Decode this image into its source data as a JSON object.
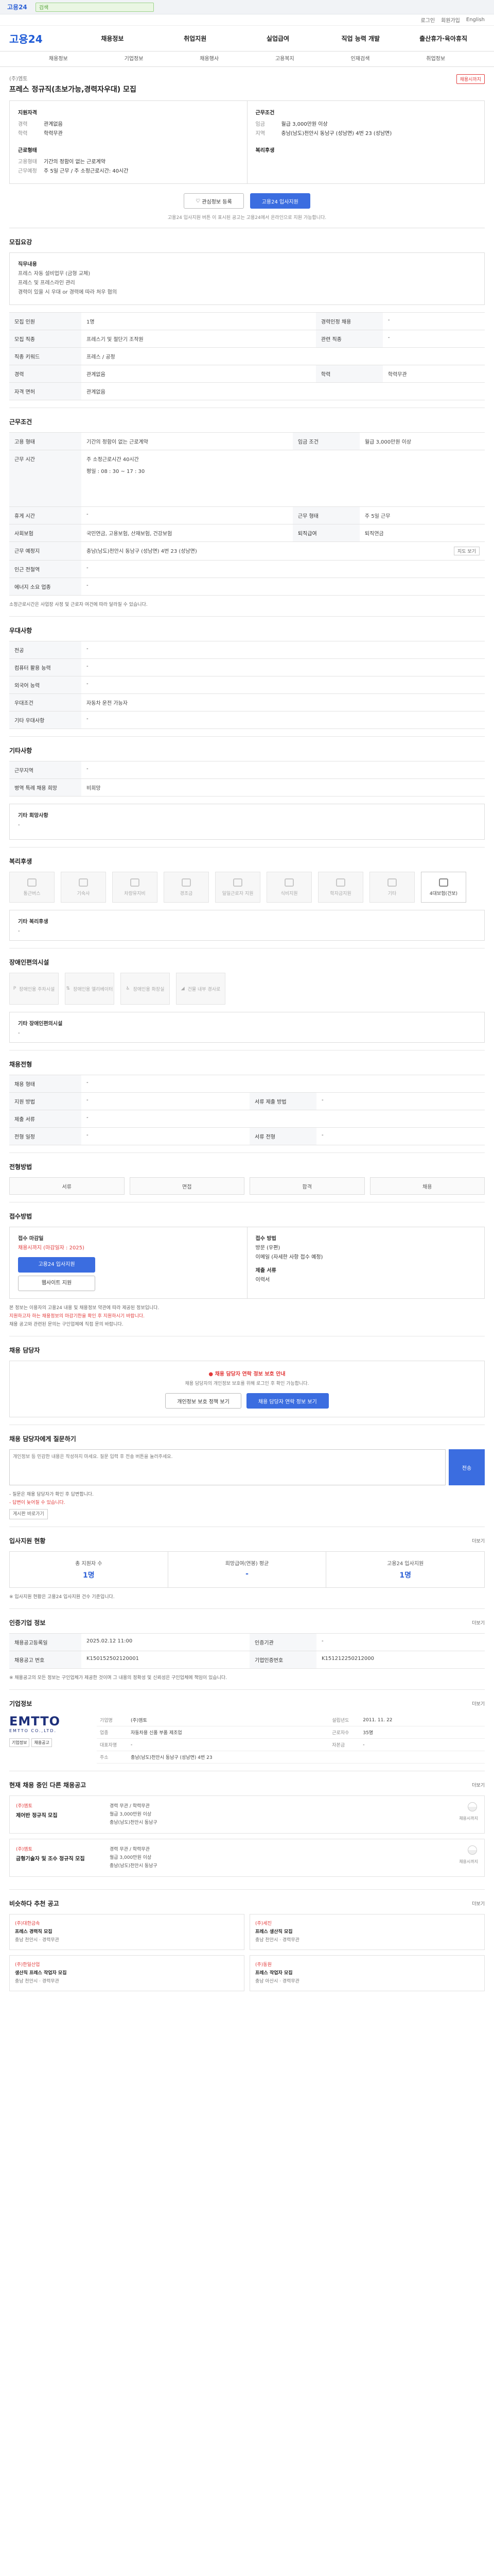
{
  "topbar": {
    "logo": "고용24",
    "search_placeholder": "검색"
  },
  "utilbar": [
    "로그인",
    "회원가입",
    "English"
  ],
  "gnb": {
    "logo": "고용24",
    "menu": [
      "채용정보",
      "취업지원",
      "실업급여",
      "직업 능력 개발",
      "출산휴가·육아휴직"
    ]
  },
  "subnav": [
    "채용정보",
    "기업정보",
    "채용행사",
    "고용복지",
    "인재검색",
    "취업정보"
  ],
  "job": {
    "company": "(주)엠토",
    "title": "프레스 정규직(초보가능,경력자우대) 모집",
    "badge": "채용시까지",
    "left_head": "지원자격",
    "left_rows": [
      [
        "경력",
        "관계없음"
      ],
      [
        "학력",
        "학력무관"
      ]
    ],
    "left_head2": "근로형태",
    "left_rows2": [
      [
        "고용형태",
        "기간의 정함이 없는 근로계약"
      ],
      [
        "근무예정",
        "주 5일 근무 / 주 소정근로시간: 40시간"
      ]
    ],
    "right_head": "근무조건",
    "right_rows": [
      [
        "임금",
        "월급 3,000만원 이상"
      ],
      [
        "지역",
        "충남(남도)천안시 동남구 (성남면) 4번 23 (성남면)"
      ]
    ],
    "right_head2": "복리후생",
    "btn_scrap": "관심정보 등록",
    "btn_apply": "고용24 입사지원",
    "notice": "고용24 입사지원 버튼 이 표시된 공고는 고용24에서 온라인으로 지원 가능합니다."
  },
  "detail": {
    "title": "모집요강",
    "box": [
      "직무내용",
      "프레스 자동 설비업무 (금형 교체)",
      "프레스 및 프레스라인 관리",
      "경력이 있을 시 우대 or 경력에 따라 처우 협의"
    ],
    "rows": [
      [
        "모집 인원",
        "1명",
        "경력인정 채용",
        "-"
      ],
      [
        "모집 직종",
        "프레스기 및 절단기 조작원",
        "관련 직종",
        "-"
      ],
      [
        "직종 키워드",
        "프레스 / 공정",
        "",
        ""
      ],
      [
        "경력",
        "관계없음",
        "학력",
        "학력무관"
      ],
      [
        "자격 면허",
        "관계없음",
        "",
        ""
      ]
    ]
  },
  "work": {
    "title": "근무조건",
    "rows": [
      [
        "고용 형태",
        "기간의 정함이 없는 근로계약",
        "임금 조건",
        "월급 3,000만원 이상"
      ],
      [
        "근무 시간",
        "주 소정근로시간 40시간",
        "",
        ""
      ],
      [
        "휴게 시간",
        "-",
        "근무 형태",
        "주 5일 근무"
      ],
      [
        "사회보험",
        "국민연금, 고용보험, 산재보험, 건강보험",
        "퇴직급여",
        "퇴직연금"
      ],
      [
        "근무 예정지",
        "충남(남도)천안시 동남구 (성남면) 4번 23 (성남면)",
        "",
        ""
      ],
      [
        "인근 전철역",
        "-",
        "",
        ""
      ],
      [
        "에너지 소요 업종",
        "-",
        "",
        ""
      ]
    ],
    "hours": "평일 : 08 : 30 ~ 17 : 30",
    "map_btn": "지도 보기",
    "footnote": "소정근로시간은 사업장 사정 및 근로자 여건에 따라 달라질 수 있습니다."
  },
  "prefer": {
    "title": "우대사항",
    "rows": [
      [
        "전공",
        "-"
      ],
      [
        "컴퓨터 활용 능력",
        "-"
      ],
      [
        "외국어 능력",
        "-"
      ],
      [
        "우대조건",
        "자동차 운전 가능자"
      ],
      [
        "기타 우대사항",
        "-"
      ]
    ]
  },
  "etc": {
    "title": "기타사항",
    "rows": [
      [
        "근무지역",
        "-"
      ],
      [
        "병역 특례 채용 희망",
        "비희망"
      ]
    ],
    "box_title": "기타 회망사항",
    "box_val": "-"
  },
  "welfare": {
    "title": "복리후생",
    "items": [
      "통근버스",
      "기숙사",
      "차량유지비",
      "경조금",
      "일일근로자 지원",
      "식비지원",
      "학자금지원",
      "기타",
      "4대보험(건보)"
    ],
    "active_index": 8,
    "other_title": "기타 복리후생",
    "other_val": "-"
  },
  "disabled": {
    "title": "장애인편의시설",
    "items": [
      "장애인용 주차시설",
      "장애인용 엘리베이터",
      "장애인용 화장실",
      "건물 내부 경사로"
    ],
    "other_title": "기타 장애인편의시설",
    "other_val": "-"
  },
  "recruit": {
    "title": "채용전형",
    "rows": [
      [
        "채용 형태",
        "-",
        "",
        ""
      ],
      [
        "지원 방법",
        "-",
        "서류 제출 방법",
        "-"
      ],
      [
        "제출 서류",
        "-",
        "",
        ""
      ],
      [
        "전형 일정",
        "-",
        "서류 전형",
        "-"
      ]
    ]
  },
  "process": {
    "title": "전형방법",
    "steps": [
      "서류",
      "면접",
      "합격",
      "채용"
    ]
  },
  "apply": {
    "title": "접수방법",
    "l_head": "접수 마감일",
    "l_val": "채용시까지 (마감일자 : 2025)",
    "l_btn1": "고용24 입사지원",
    "l_btn2": "웹사이트 지원",
    "r_head": "접수 방법",
    "r_rows": [
      "방문 (우편)",
      "이메일 (자세한 사항 접수 예정)",
      "제출 서류",
      "이력서"
    ],
    "notes": [
      "본 정보는 이용자의 고용24 내용 및 채용정보 약관에 따라 제공된 정보입니다.",
      "지원하고자 하는 채용정보의 마감기한을 확인 후 지원하시기 바랍니다.",
      "채용 공고와 관련된 문의는 구인업체에 직접 문의 바랍니다."
    ]
  },
  "contact": {
    "title": "채용 담당자",
    "warn": "채용 담당자 연락 정보 보호 안내",
    "desc": "채용 담당자의 개인정보 보호를 위해 로그인 후 확인 가능합니다.",
    "btn1": "개인정보 보호 정책 보기",
    "btn2": "채용 담당자 연락 정보 보기"
  },
  "inquiry": {
    "title": "채용 담당자에게 질문하기",
    "placeholder": "개인정보 등 민감한 내용은 작성하지 마세요. 질문 입력 후 전송 버튼을 눌러주세요.",
    "send": "전송",
    "notes": [
      "- 질문은 채용 담당자가 확인 후 답변합니다.",
      "- 답변이 늦어질 수 있습니다."
    ],
    "more": "게시판 바로가기"
  },
  "stats": {
    "title": "입사지원 현황",
    "more": "더보기",
    "items": [
      [
        "총 지원자 수",
        "1명"
      ],
      [
        "희망급여(연봉) 평균",
        "-"
      ],
      [
        "고용24 입사지원",
        "1명"
      ]
    ],
    "note": "※ 입사지원 현황은 고용24 입사지원 건수 기준입니다."
  },
  "info": {
    "title": "인증기업 정보",
    "more": "더보기",
    "rows": [
      [
        "채용공고등록일",
        "2025.02.12 11:00",
        "인증기관",
        "-"
      ],
      [
        "채용공고 번호",
        "K150152502120001",
        "기업인증번호",
        "K151212250212000"
      ]
    ],
    "note": "※ 채용공고의 모든 정보는 구인업체가 제공한 것이며 그 내용의 정확성 및 신뢰성은 구인업체에 책임이 있습니다."
  },
  "corp": {
    "title": "기업정보",
    "more": "더보기",
    "logo": "EMTTO",
    "logo_sub": "EMTTO CO.,LTD.",
    "logo_btns": [
      "기업정보",
      "채용공고"
    ],
    "rows": [
      [
        "기업명",
        "(주)엠토",
        "설립년도",
        "2011. 11. 22"
      ],
      [
        "업종",
        "자동차용 신품 부품 제조업",
        "근로자수",
        "35명"
      ],
      [
        "대표자명",
        "-",
        "자본금",
        "-"
      ],
      [
        "주소",
        "충남(남도)천안시 동남구 (성남면) 4번 23",
        "",
        ""
      ]
    ]
  },
  "otherjobs": {
    "title": "현재 채용 중인 다른 채용공고",
    "more": "더보기",
    "items": [
      {
        "co": "(주)엠토",
        "title": "제어반 정규직 모집",
        "meta": [
          "경력 무관 / 학력무관",
          "월급 3,000만원 이상",
          "충남(남도)천안시 동남구"
        ],
        "date": "채용시까지"
      },
      {
        "co": "(주)엠토",
        "title": "금형기술자 및 조수 정규직 모집",
        "meta": [
          "경력 무관 / 학력무관",
          "월급 3,000만원 이상",
          "충남(남도)천안시 동남구"
        ],
        "date": "채용시까지"
      }
    ]
  },
  "similar": {
    "title": "비슷하다 추천 공고",
    "more": "더보기",
    "items": [
      {
        "co": "(주)대한금속",
        "title": "프레스 경력직 모집",
        "meta": "충남 천안시 · 경력무관"
      },
      {
        "co": "(주)세진",
        "title": "프레스 생산직 모집",
        "meta": "충남 천안시 · 경력무관"
      },
      {
        "co": "(주)한일산업",
        "title": "생산직 프레스 작업자 모집",
        "meta": "충남 천안시 · 경력무관"
      },
      {
        "co": "(주)동원",
        "title": "프레스 작업자 모집",
        "meta": "충남 아산시 · 경력무관"
      }
    ]
  }
}
